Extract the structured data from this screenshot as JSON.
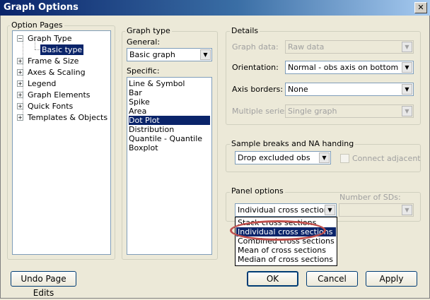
{
  "window": {
    "title": "Graph Options",
    "close_glyph": "✕"
  },
  "option_pages": {
    "label": "Option Pages",
    "items": [
      {
        "label": "Graph Type",
        "expander": "−"
      },
      {
        "label": "Basic type",
        "selected": true
      },
      {
        "label": "Frame & Size",
        "expander": "+"
      },
      {
        "label": "Axes & Scaling",
        "expander": "+"
      },
      {
        "label": "Legend",
        "expander": "+"
      },
      {
        "label": "Graph Elements",
        "expander": "+"
      },
      {
        "label": "Quick Fonts",
        "expander": "+"
      },
      {
        "label": "Templates & Objects",
        "expander": "+"
      }
    ]
  },
  "graph_type": {
    "group_label": "Graph type",
    "general_label": "General:",
    "general_value": "Basic graph",
    "specific_label": "Specific:",
    "specific_items": [
      "Line & Symbol",
      "Bar",
      "Spike",
      "Area",
      "Dot Plot",
      "Distribution",
      "Quantile - Quantile",
      "Boxplot"
    ],
    "specific_selected": "Dot Plot"
  },
  "details": {
    "group_label": "Details",
    "graph_data_label": "Graph data:",
    "graph_data_value": "Raw data",
    "orientation_label": "Orientation:",
    "orientation_value": "Normal - obs axis on bottom",
    "axis_borders_label": "Axis borders:",
    "axis_borders_value": "None",
    "multiple_series_label": "Multiple series:",
    "multiple_series_value": "Single graph"
  },
  "sample_breaks": {
    "group_label": "Sample breaks and NA handing",
    "value": "Drop excluded obs",
    "connect_label": "Connect adjacent"
  },
  "panel_options": {
    "group_label": "Panel options",
    "value": "Individual cross sections",
    "num_sds_label": "Number of SDs:",
    "dropdown_items": [
      "Stack cross sections",
      "Individual cross sections",
      "Combined cross sections",
      "Mean of cross sections",
      "Median of cross sections"
    ],
    "dropdown_selected": "Individual cross sections"
  },
  "buttons": {
    "undo": "Undo Page Edits",
    "ok": "OK",
    "cancel": "Cancel",
    "apply": "Apply"
  },
  "icons": {
    "dropdown_arrow": "▼"
  },
  "colors": {
    "selection": "#0a246a",
    "highlight_ellipse": "#c0504d",
    "title_bar": "#0a246a"
  }
}
